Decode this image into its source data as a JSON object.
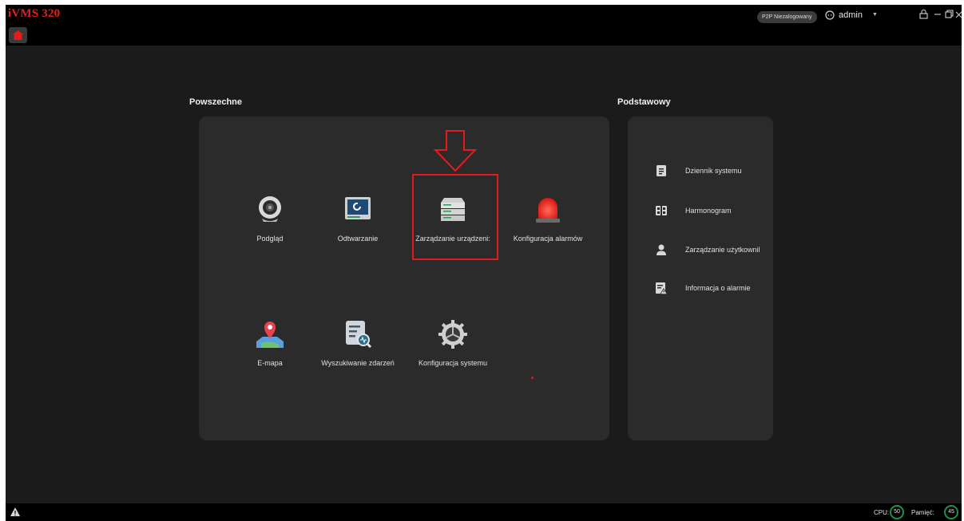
{
  "app": {
    "title": "iVMS 320"
  },
  "header": {
    "p2p_status": "P2P Niezalogowany",
    "user": "admin"
  },
  "sections": {
    "general": {
      "title": "Powszechne",
      "tiles": [
        {
          "label": "Podgląd",
          "icon": "webcam-icon"
        },
        {
          "label": "Odtwarzanie",
          "icon": "playback-monitor-icon"
        },
        {
          "label": "Zarządzanie urządzeni:",
          "icon": "server-rack-icon"
        },
        {
          "label": "Konfiguracja alarmów",
          "icon": "alarm-light-icon"
        },
        {
          "label": "E-mapa",
          "icon": "map-pin-icon"
        },
        {
          "label": "Wyszukiwanie zdarzeń",
          "icon": "event-search-icon"
        },
        {
          "label": "Konfiguracja systemu",
          "icon": "gear-icon"
        }
      ]
    },
    "basic": {
      "title": "Podstawowy",
      "items": [
        {
          "label": "Dziennik systemu",
          "icon": "log-icon"
        },
        {
          "label": "Harmonogram",
          "icon": "schedule-icon"
        },
        {
          "label": "Zarządzanie użytkownil",
          "icon": "user-icon"
        },
        {
          "label": "Informacja o alarmie",
          "icon": "alarm-info-icon"
        }
      ]
    }
  },
  "status": {
    "cpu_label": "CPU:",
    "cpu_value": "50",
    "memory_label": "Pamięć:",
    "memory_value": "45"
  },
  "colors": {
    "accent": "#e21c1c",
    "background": "#1b1b1b",
    "panel": "#2b2b2b",
    "indicator": "#1f8f4a"
  }
}
